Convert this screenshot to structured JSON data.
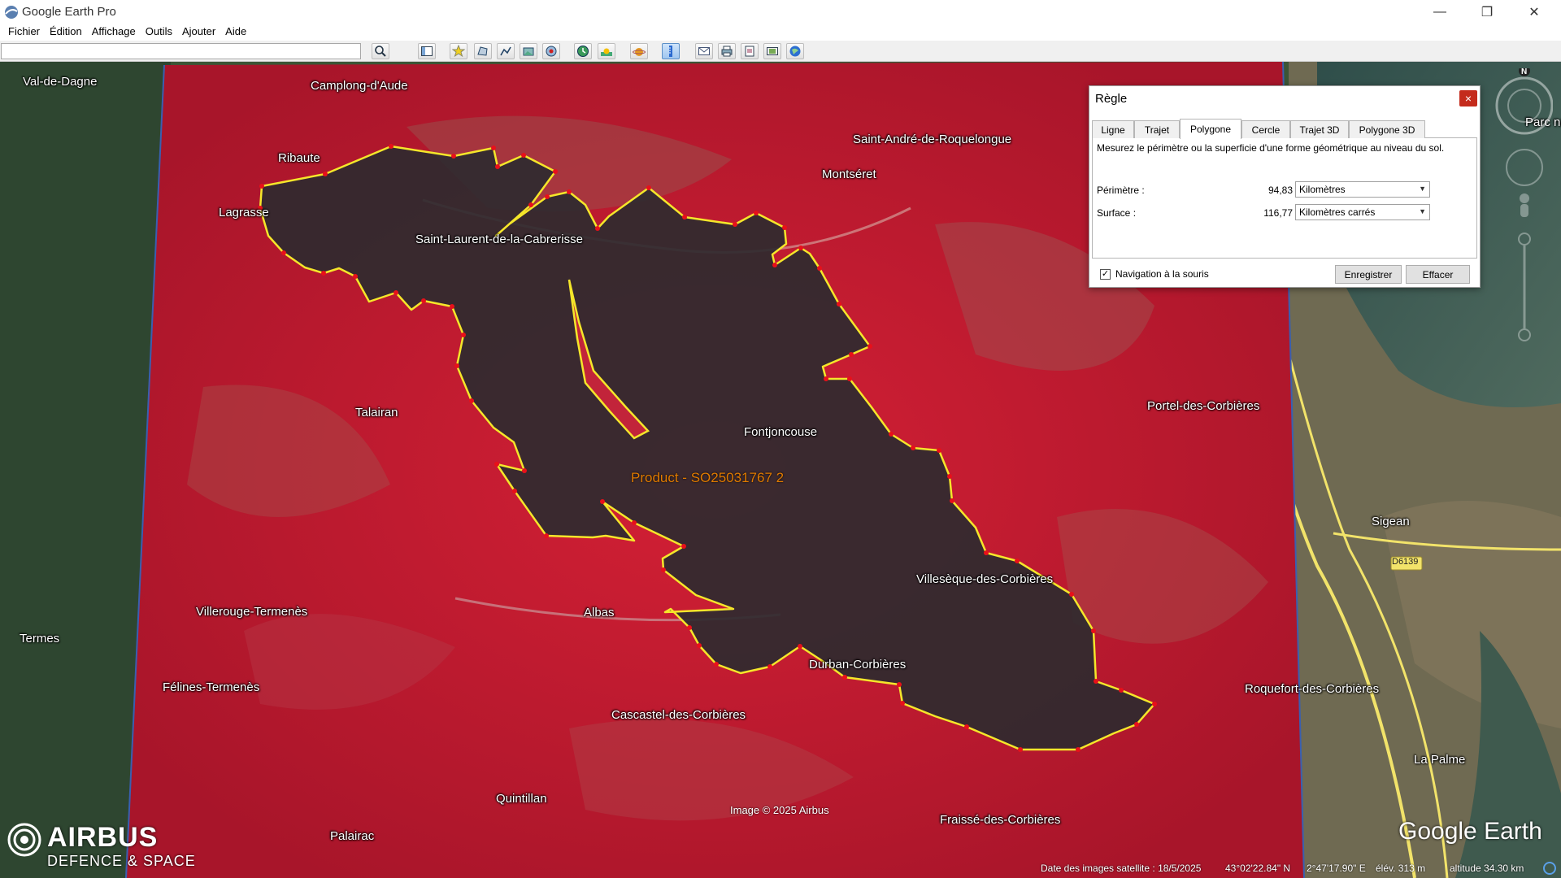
{
  "window": {
    "title": "Google Earth Pro",
    "minimize": "—",
    "restore": "❐",
    "close": "✕"
  },
  "menu": [
    "Fichier",
    "Édition",
    "Affichage",
    "Outils",
    "Ajouter",
    "Aide"
  ],
  "search": {
    "value": "",
    "placeholder": ""
  },
  "toolbar_icons": [
    "search-icon",
    "sidebar-icon",
    "placemark-icon",
    "polygon-icon",
    "path-icon",
    "overlay-icon",
    "tour-icon",
    "history-icon",
    "sun-icon",
    "planets-icon",
    "ruler-icon",
    "email-icon",
    "print-icon",
    "save-image-icon",
    "movie-icon",
    "maps-icon"
  ],
  "places": [
    {
      "name": "Val-de-Dagne"
    },
    {
      "name": "Camplong-d'Aude"
    },
    {
      "name": "Ribaute"
    },
    {
      "name": "Lagrasse"
    },
    {
      "name": "Saint-Laurent-de-la-Cabrerisse"
    },
    {
      "name": "Saint-André-de-Roquelongue"
    },
    {
      "name": "Montséret"
    },
    {
      "name": "Talairan"
    },
    {
      "name": "Fontjoncouse"
    },
    {
      "name": "Portel-des-Corbières"
    },
    {
      "name": "Sigean"
    },
    {
      "name": "Villesèque-des-Corbières"
    },
    {
      "name": "Villerouge-Termenès"
    },
    {
      "name": "Albas"
    },
    {
      "name": "Termes"
    },
    {
      "name": "Durban-Corbières"
    },
    {
      "name": "Félines-Termenès"
    },
    {
      "name": "Roquefort-des-Corbières"
    },
    {
      "name": "Cascastel-des-Corbières"
    },
    {
      "name": "La Palme"
    },
    {
      "name": "Quintillan"
    },
    {
      "name": "Fraissé-des-Corbières"
    },
    {
      "name": "Palairac"
    },
    {
      "name": "Parc nat"
    },
    {
      "name": "D6139"
    }
  ],
  "product_label": "Product - SO25031767 2",
  "image_credit": "Image © 2025 Airbus",
  "airbus": {
    "name": "AIRBUS",
    "division": "DEFENCE & SPACE"
  },
  "google_earth_logo": "Google Earth",
  "status": {
    "imagery_date": "Date des images satellite : 18/5/2025",
    "lat": "43°02'22.84\" N",
    "lon": "2°47'17.90\" E",
    "elev": "élév.  313 m",
    "altitude": "altitude  34.30 km"
  },
  "ruler": {
    "title": "Règle",
    "close": "×",
    "tabs": [
      "Ligne",
      "Trajet",
      "Polygone",
      "Cercle",
      "Trajet 3D",
      "Polygone 3D"
    ],
    "active_tab": "Polygone",
    "description": "Mesurez le périmètre ou la superficie d'une forme géométrique au niveau du sol.",
    "perimeter_label": "Périmètre :",
    "perimeter_value": "94,83",
    "perimeter_unit": "Kilomètres",
    "area_label": "Surface :",
    "area_value": "116,77",
    "area_unit": "Kilomètres carrés",
    "mouse_nav_label": "Navigation à la souris",
    "mouse_nav_checked": true,
    "check_mark": "✓",
    "save_button": "Enregistrer",
    "clear_button": "Effacer"
  },
  "colors": {
    "burn_overlay": "#c81e32",
    "burn_scar": "#2e2a2f",
    "polygon_stroke": "#f5e62a",
    "vertex": "#e8101a",
    "forest": "#2f4a32",
    "road": "#f2e36a"
  }
}
